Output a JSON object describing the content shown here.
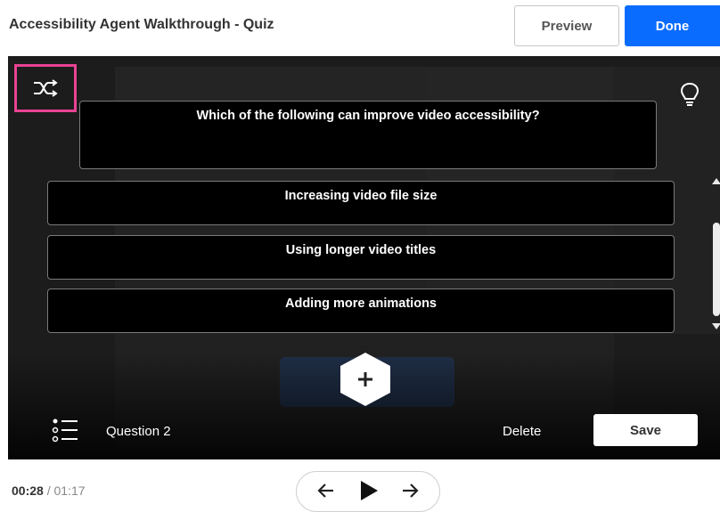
{
  "header": {
    "title": "Accessibility Agent Walkthrough - Quiz",
    "preview_label": "Preview",
    "done_label": "Done",
    "done_color": "#0a6cff"
  },
  "quiz": {
    "question": "Which of the following can improve video accessibility?",
    "answers": [
      "Increasing video file size",
      "Using longer video titles",
      "Adding more animations"
    ],
    "question_label": "Question 2",
    "delete_label": "Delete",
    "save_label": "Save",
    "highlight_color": "#e94393"
  },
  "icons": {
    "shuffle": "shuffle-icon",
    "hint": "lightbulb-icon",
    "add": "plus-icon",
    "list": "question-list-icon"
  },
  "player": {
    "current_time": "00:28",
    "separator": "/",
    "total_time": "01:17"
  }
}
